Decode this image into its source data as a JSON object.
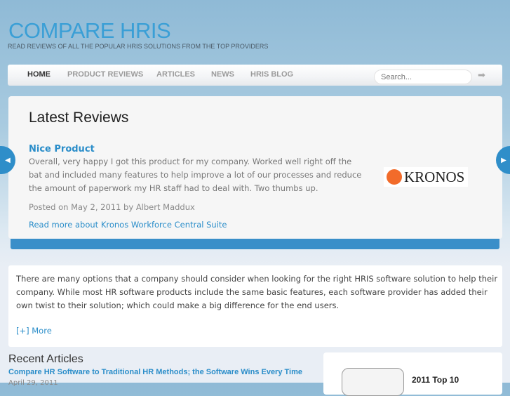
{
  "site": {
    "title": "COMPARE HRIS",
    "tagline": "READ REVIEWS OF ALL THE POPULAR HRIS SOLUTIONS FROM THE TOP PROVIDERS"
  },
  "nav": {
    "items": [
      {
        "label": "HOME"
      },
      {
        "label": "PRODUCT REVIEWS"
      },
      {
        "label": "ARTICLES"
      },
      {
        "label": "NEWS"
      },
      {
        "label": "HRIS BLOG"
      }
    ],
    "search_placeholder": "Search..."
  },
  "slider": {
    "heading": "Latest Reviews",
    "review_title": "Nice Product",
    "review_body": "Overall, very happy I got this product for my company. Worked well right off the bat and included many features to help improve a lot of our processes and reduce the amount of paperwork my HR staff had to deal with. Two thumbs up.",
    "posted": "Posted on May 2, 2011 by Albert Maddux",
    "read_more": "Read more about Kronos Workforce Central Suite",
    "logo_text": "KRONOS"
  },
  "intro": {
    "text": "There are many options that a company should consider when looking for the right HRIS software solution to help their company. While most HR software products include the same basic features, each software provider has added their own twist to their solution; which could make a big difference for the end users.",
    "more": "[+] More"
  },
  "recent": {
    "heading": "Recent Articles",
    "articles": [
      {
        "title": "Compare HR Software to Traditional HR Methods; the Software Wins Every Time",
        "date": "April 29, 2011"
      }
    ]
  },
  "sidebar": {
    "title": "2011 Top 10"
  }
}
